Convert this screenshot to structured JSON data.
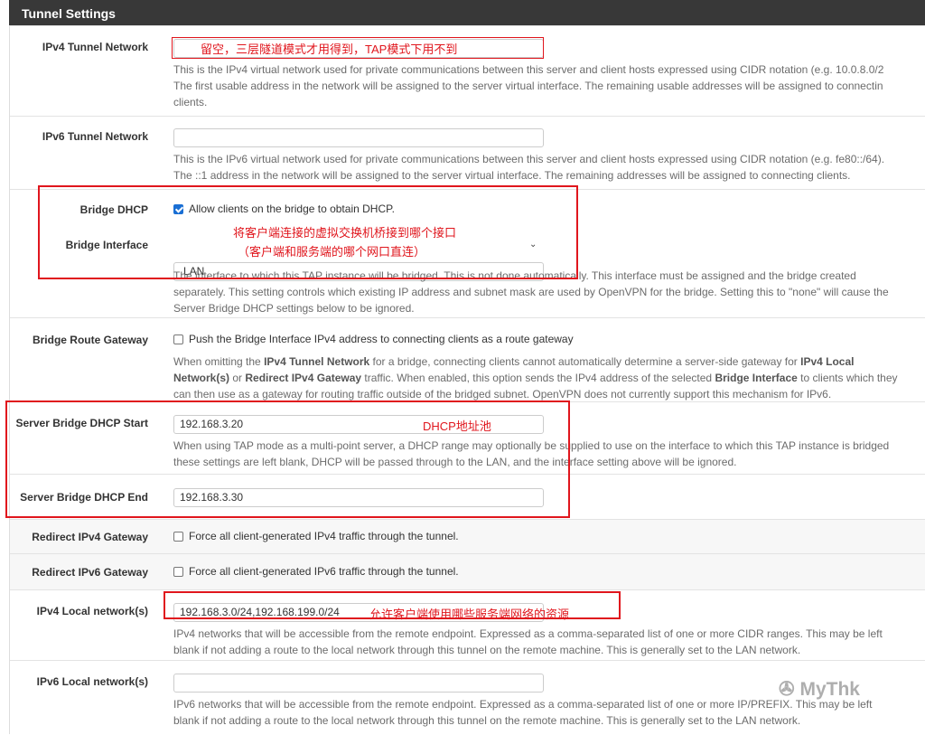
{
  "panel_title": "Tunnel Settings",
  "ipv4_tunnel": {
    "label": "IPv4 Tunnel Network",
    "value": "",
    "annotation": "留空，三层隧道模式才用得到，TAP模式下用不到",
    "help": [
      "This is the IPv4 virtual network used for private communications between this server and client hosts expressed using CIDR notation (e.g. 10.0.8.0/2",
      "The first usable address in the network will be assigned to the server virtual interface. The remaining usable addresses will be assigned to connectin",
      "clients."
    ]
  },
  "ipv6_tunnel": {
    "label": "IPv6 Tunnel Network",
    "value": "",
    "help": [
      "This is the IPv6 virtual network used for private communications between this server and client hosts expressed using CIDR notation (e.g. fe80::/64).",
      "The ::1 address in the network will be assigned to the server virtual interface. The remaining addresses will be assigned to connecting clients."
    ]
  },
  "bridge_dhcp": {
    "label": "Bridge DHCP",
    "checked": true,
    "checkbox_label": "Allow clients on the bridge to obtain DHCP."
  },
  "bridge_interface": {
    "label": "Bridge Interface",
    "selected": "LAN",
    "annotation_line1": "将客户端连接的虚拟交换机桥接到哪个接口",
    "annotation_line2": "（客户端和服务端的哪个网口直连）",
    "help": [
      "The interface to which this TAP instance will be bridged. This is not done automatically. This interface must be assigned and the bridge created",
      "separately. This setting controls which existing IP address and subnet mask are used by OpenVPN for the bridge. Setting this to \"none\" will cause the",
      "Server Bridge DHCP settings below to be ignored."
    ]
  },
  "bridge_route_gateway": {
    "label": "Bridge Route Gateway",
    "checked": false,
    "checkbox_label": "Push the Bridge Interface IPv4 address to connecting clients as a route gateway",
    "help": {
      "l1a": "When omitting the ",
      "l1b": "IPv4 Tunnel Network",
      "l1c": " for a bridge, connecting clients cannot automatically determine a server-side gateway for ",
      "l1d": "IPv4 Local",
      "l2a": "Network(s)",
      "l2b": " or ",
      "l2c": "Redirect IPv4 Gateway",
      "l2d": " traffic. When enabled, this option sends the IPv4 address of the selected ",
      "l2e": "Bridge Interface",
      "l2f": " to clients which they",
      "l3": "can then use as a gateway for routing traffic outside of the bridged subnet. OpenVPN does not currently support this mechanism for IPv6."
    }
  },
  "dhcp_start": {
    "label": "Server Bridge DHCP Start",
    "value": "192.168.3.20",
    "annotation": "DHCP地址池",
    "help": [
      "When using TAP mode as a multi-point server, a DHCP range may optionally be supplied to use on the interface to which this TAP instance is bridged",
      "these settings are left blank, DHCP will be passed through to the LAN, and the interface setting above will be ignored."
    ]
  },
  "dhcp_end": {
    "label": "Server Bridge DHCP End",
    "value": "192.168.3.30"
  },
  "redirect_ipv4": {
    "label": "Redirect IPv4 Gateway",
    "checked": false,
    "checkbox_label": "Force all client-generated IPv4 traffic through the tunnel."
  },
  "redirect_ipv6": {
    "label": "Redirect IPv6 Gateway",
    "checked": false,
    "checkbox_label": "Force all client-generated IPv6 traffic through the tunnel."
  },
  "ipv4_local": {
    "label": "IPv4 Local network(s)",
    "value": "192.168.3.0/24,192.168.199.0/24",
    "annotation": "允许客户端使用哪些服务端网络的资源",
    "help": [
      "IPv4 networks that will be accessible from the remote endpoint. Expressed as a comma-separated list of one or more CIDR ranges. This may be left",
      "blank if not adding a route to the local network through this tunnel on the remote machine. This is generally set to the LAN network."
    ]
  },
  "ipv6_local": {
    "label": "IPv6 Local network(s)",
    "value": "",
    "help": [
      "IPv6 networks that will be accessible from the remote endpoint. Expressed as a comma-separated list of one or more IP/PREFIX. This may be left",
      "blank if not adding a route to the local network through this tunnel on the remote machine. This is generally set to the LAN network."
    ]
  },
  "watermark": "MyThk",
  "annotation_color": "#e0161d",
  "checkbox_accent": "#1a6fd4"
}
